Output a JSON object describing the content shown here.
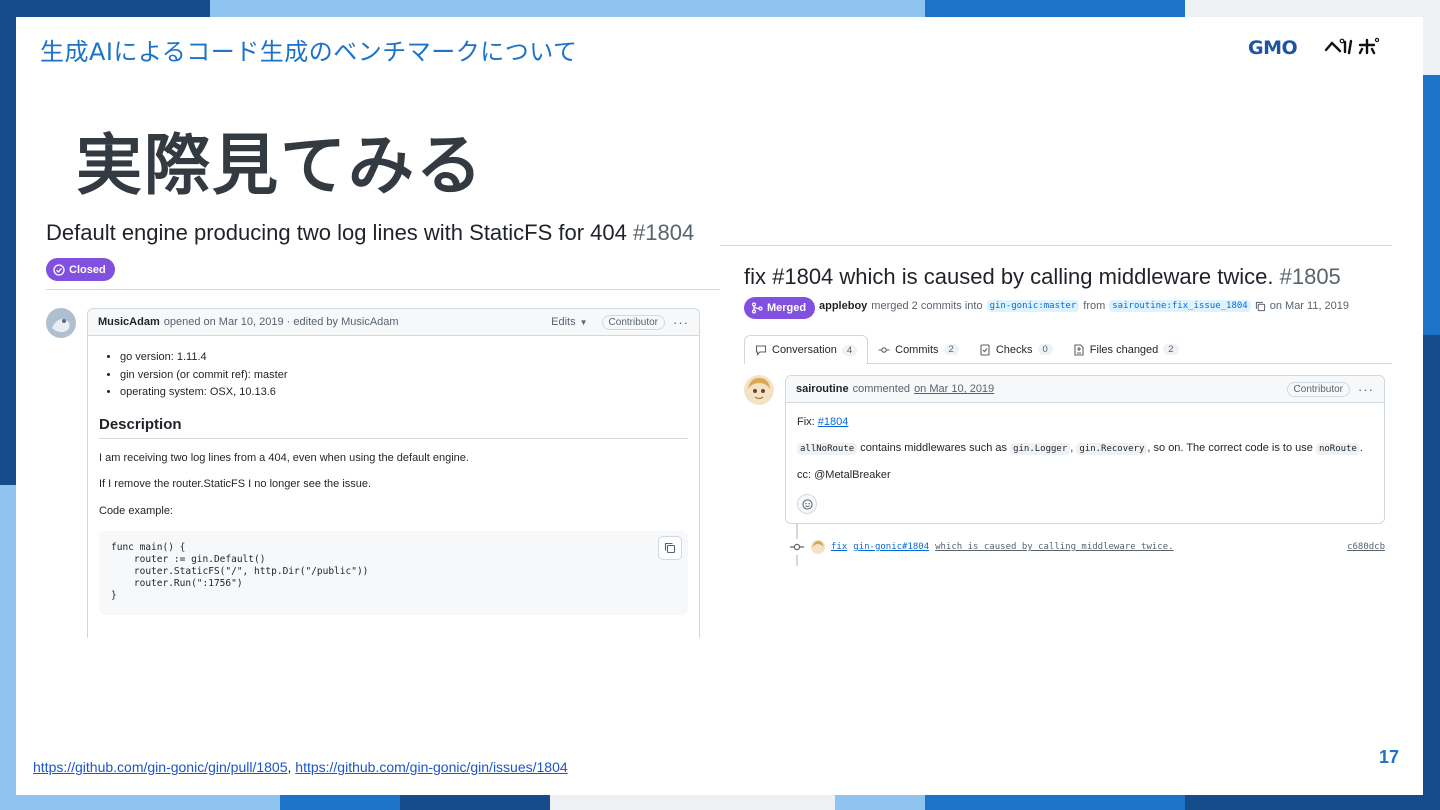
{
  "slide": {
    "header_title": "生成AIによるコード生成のベンチマークについて",
    "title": "実際見てみる",
    "page_number": "17",
    "logo_alt": "GMOペパボ",
    "footer_links": [
      "https://github.com/gin-gonic/gin/pull/1805",
      "https://github.com/gin-gonic/gin/issues/1804"
    ],
    "footer_separator": ", "
  },
  "colors": {
    "accent_blue": "#1c73c8",
    "dark_blue": "#154c8c",
    "light_blue": "#8fc4f0",
    "github_purple": "#8250df",
    "github_link": "#0969da"
  },
  "issue": {
    "title": "Default engine producing two log lines with StaticFS for 404",
    "number": "#1804",
    "state_label": "Closed",
    "state_icon": "circle-check-icon",
    "author": "MusicAdam",
    "meta": "opened on Mar 10, 2019 · edited by MusicAdam",
    "edits_label": "Edits",
    "role_badge": "Contributor",
    "specs": [
      "go version: 1.11.4",
      "gin version (or commit ref): master",
      "operating system: OSX, 10.13.6"
    ],
    "description_heading": "Description",
    "paragraphs": [
      "I am receiving two log lines from a 404, even when using the default engine.",
      "If I remove the router.StaticFS I no longer see the issue.",
      "Code example:"
    ],
    "code_lines": [
      "func main() {",
      "    router := gin.Default()",
      "    router.StaticFS(\"/\", http.Dir(\"/public\"))",
      "    router.Run(\":1756\")",
      "}"
    ]
  },
  "pr": {
    "title": "fix #1804 which is caused by calling middleware twice.",
    "number": "#1805",
    "state_label": "Merged",
    "state_icon": "git-merge-icon",
    "author": "appleboy",
    "merged_text": "merged 2 commits into",
    "base_branch": "gin-gonic:master",
    "from_text": "from",
    "head_branch": "sairoutine:fix_issue_1804",
    "date_text": "on Mar 11, 2019",
    "tabs": [
      {
        "label": "Conversation",
        "count": "4",
        "icon": "comment-icon"
      },
      {
        "label": "Commits",
        "count": "2",
        "icon": "commit-icon"
      },
      {
        "label": "Checks",
        "count": "0",
        "icon": "checklist-icon"
      },
      {
        "label": "Files changed",
        "count": "2",
        "icon": "file-diff-icon"
      }
    ],
    "comment": {
      "author": "sairoutine",
      "action": "commented",
      "date": "on Mar 10, 2019",
      "role_badge": "Contributor",
      "fix_prefix": "Fix:",
      "fix_link": "#1804",
      "body_code_1": "allNoRoute",
      "body_text_1": "contains middlewares such as",
      "body_code_2": "gin.Logger",
      "body_sep": ",",
      "body_code_3": "gin.Recovery",
      "body_text_2": ", so on. The correct code is to use",
      "body_code_4": "noRoute",
      "body_end": ".",
      "cc": "cc: @MetalBreaker"
    },
    "commit": {
      "label": "fix",
      "ref": "gin-gonic#1804",
      "message": "which is caused by calling middleware twice.",
      "sha": "c680dcb"
    }
  }
}
